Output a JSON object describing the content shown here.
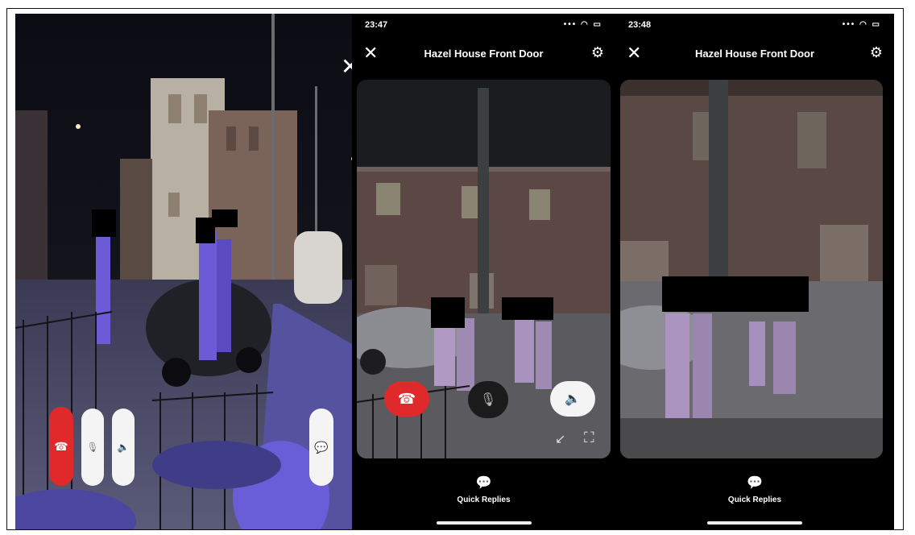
{
  "panels": [
    {
      "status_time": "23:47",
      "status_icons": "••• ◠ ▭",
      "title": "Hazel House Front Door",
      "quick_replies": "Quick Replies"
    },
    {
      "status_time": "23:48",
      "status_icons": "••• ◠ ▭",
      "title": "Hazel House Front Door",
      "quick_replies": "Quick Replies"
    }
  ],
  "icons": {
    "close": "✕",
    "gear": "⚙",
    "end_call": "☎",
    "mute": "🎙",
    "speaker": "🔈",
    "chat": "💬",
    "collapse": "↙",
    "expand": "⛶"
  },
  "colors": {
    "end_call": "#e0292b",
    "mute_bg": "#1b1b1b",
    "speaker_bg": "#f4f4f4",
    "accent_purple": "#6b5bd6"
  }
}
